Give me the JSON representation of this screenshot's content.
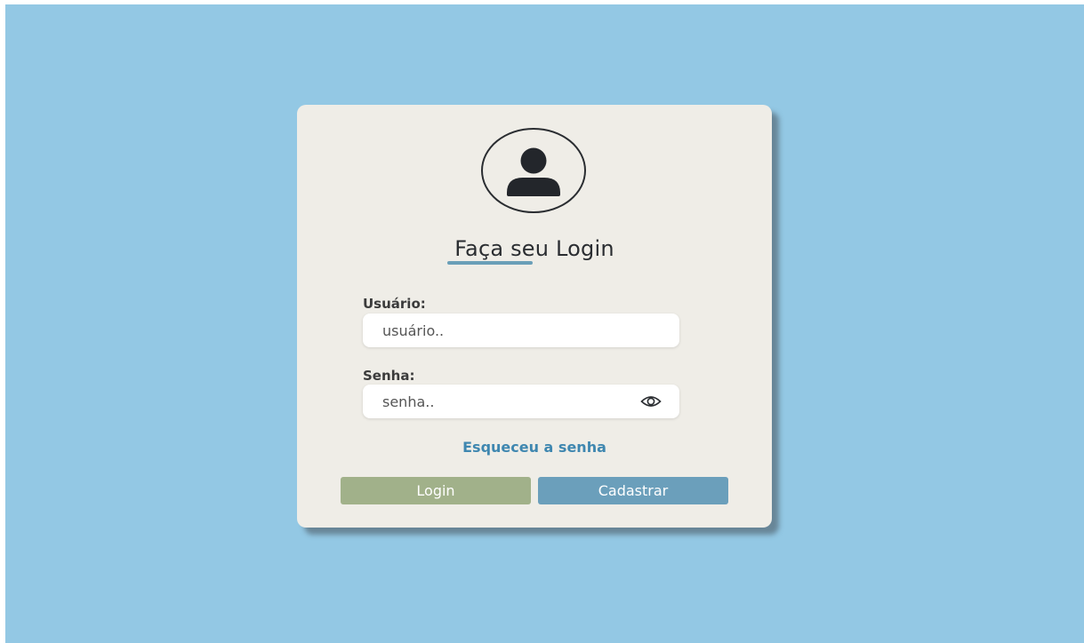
{
  "login": {
    "title": "Faça seu Login",
    "username_label": "Usuário:",
    "username_placeholder": "usuário..",
    "password_label": "Senha:",
    "password_placeholder": "senha..",
    "forgot_link": "Esqueceu a senha",
    "login_button": "Login",
    "register_button": "Cadastrar",
    "avatar_icon": "user-avatar-icon",
    "show_password_icon": "eye-icon"
  },
  "colors": {
    "background": "#93c8e4",
    "card": "#efede7",
    "accent_blue": "#6b9fbb",
    "link_blue": "#3f87b0",
    "login_green": "#a1b18a"
  }
}
